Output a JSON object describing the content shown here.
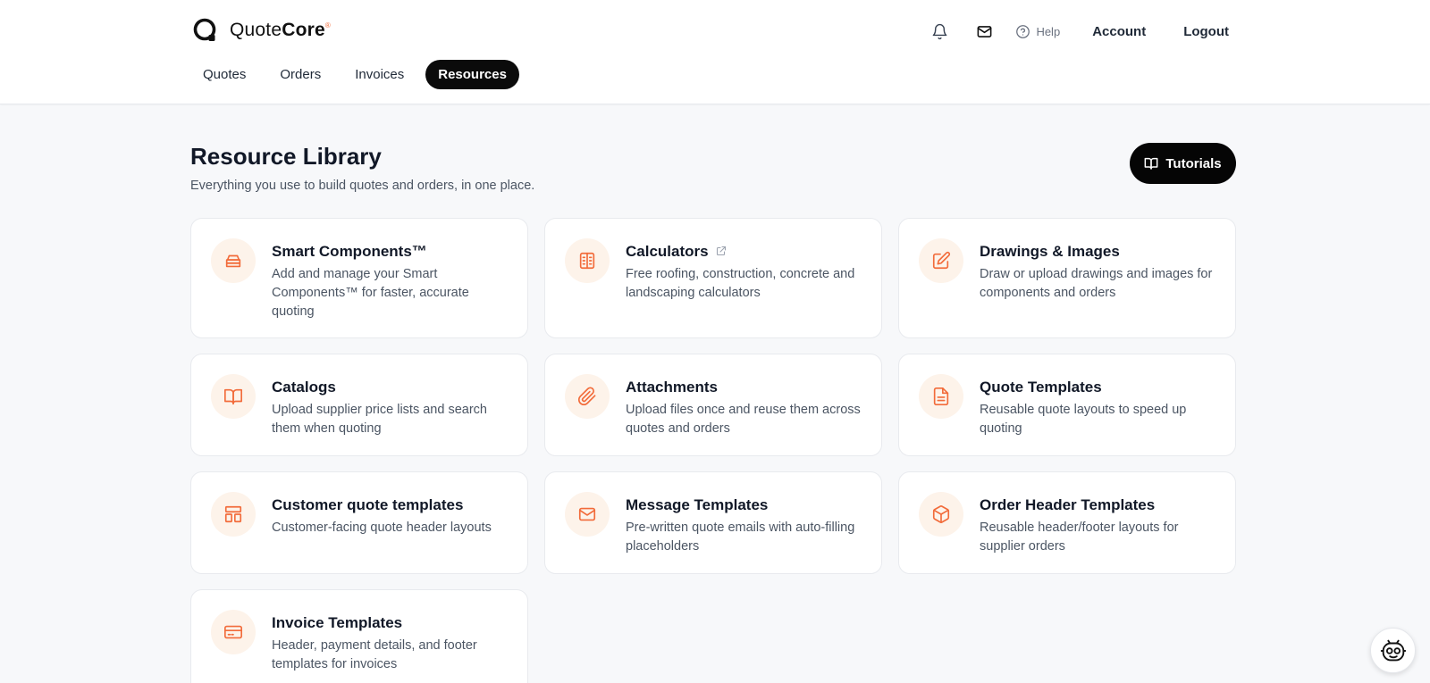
{
  "brand": {
    "name_light": "Quote",
    "name_bold": "Core",
    "mark": "®",
    "accent": "#f26b3a"
  },
  "header": {
    "help_label": "Help",
    "account_label": "Account",
    "logout_label": "Logout"
  },
  "tabs": [
    {
      "label": "Quotes",
      "active": false
    },
    {
      "label": "Orders",
      "active": false
    },
    {
      "label": "Invoices",
      "active": false
    },
    {
      "label": "Resources",
      "active": true
    }
  ],
  "page": {
    "title": "Resource Library",
    "subtitle": "Everything you use to build quotes and orders, in one place.",
    "tutorials_label": "Tutorials"
  },
  "cards": [
    {
      "title": "Smart Components™",
      "desc": "Add and manage your Smart Components™ for faster, accurate quoting",
      "icon": "stack-icon"
    },
    {
      "title": "Calculators",
      "desc": "Free roofing, construction, concrete and landscaping calculators",
      "icon": "calculator-icon",
      "external": true
    },
    {
      "title": "Drawings & Images",
      "desc": "Draw or upload drawings and images for components and orders",
      "icon": "edit-icon"
    },
    {
      "title": "Catalogs",
      "desc": "Upload supplier price lists and search them when quoting",
      "icon": "book-icon"
    },
    {
      "title": "Attachments",
      "desc": "Upload files once and reuse them across quotes and orders",
      "icon": "paperclip-icon"
    },
    {
      "title": "Quote Templates",
      "desc": "Reusable quote layouts to speed up quoting",
      "icon": "document-icon"
    },
    {
      "title": "Customer quote templates",
      "desc": "Customer-facing quote header layouts",
      "icon": "layout-icon"
    },
    {
      "title": "Message Templates",
      "desc": "Pre-written quote emails with auto-filling placeholders",
      "icon": "mail-icon"
    },
    {
      "title": "Order Header Templates",
      "desc": "Reusable header/footer layouts for supplier orders",
      "icon": "box-icon"
    },
    {
      "title": "Invoice Templates",
      "desc": "Header, payment details, and footer templates for invoices",
      "icon": "card-icon"
    }
  ]
}
